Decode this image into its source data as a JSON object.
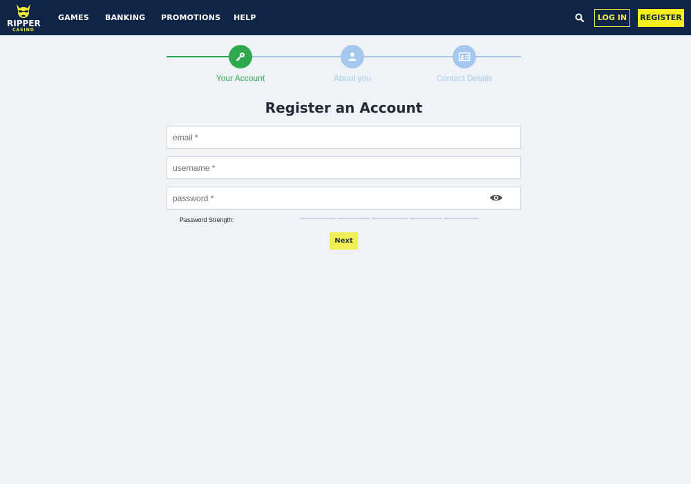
{
  "brand": {
    "name": "RIPPER",
    "sub": "CASINO"
  },
  "nav": {
    "items": [
      "GAMES",
      "BANKING",
      "PROMOTIONS",
      "HELP"
    ]
  },
  "header": {
    "search_icon": "search-icon",
    "login_label": "LOG IN",
    "register_label": "REGISTER"
  },
  "steps": [
    {
      "label": "Your Account",
      "icon": "key-icon",
      "status": "active"
    },
    {
      "label": "About you",
      "icon": "user-icon",
      "status": "pending"
    },
    {
      "label": "Contact Details",
      "icon": "id-card-icon",
      "status": "pending"
    }
  ],
  "form": {
    "title": "Register an Account",
    "email_placeholder": "email *",
    "username_placeholder": "username *",
    "password_placeholder": "password *",
    "password_toggle_icon": "eye-icon",
    "strength_label": "Password Strength:",
    "strength_level": 0,
    "next_label": "Next"
  },
  "colors": {
    "header_bg": "#0f2547",
    "accent_yellow": "#f5ef1c",
    "step_done": "#2fa84f",
    "step_pending": "#a5c8ec",
    "page_bg": "#eff3f7"
  }
}
